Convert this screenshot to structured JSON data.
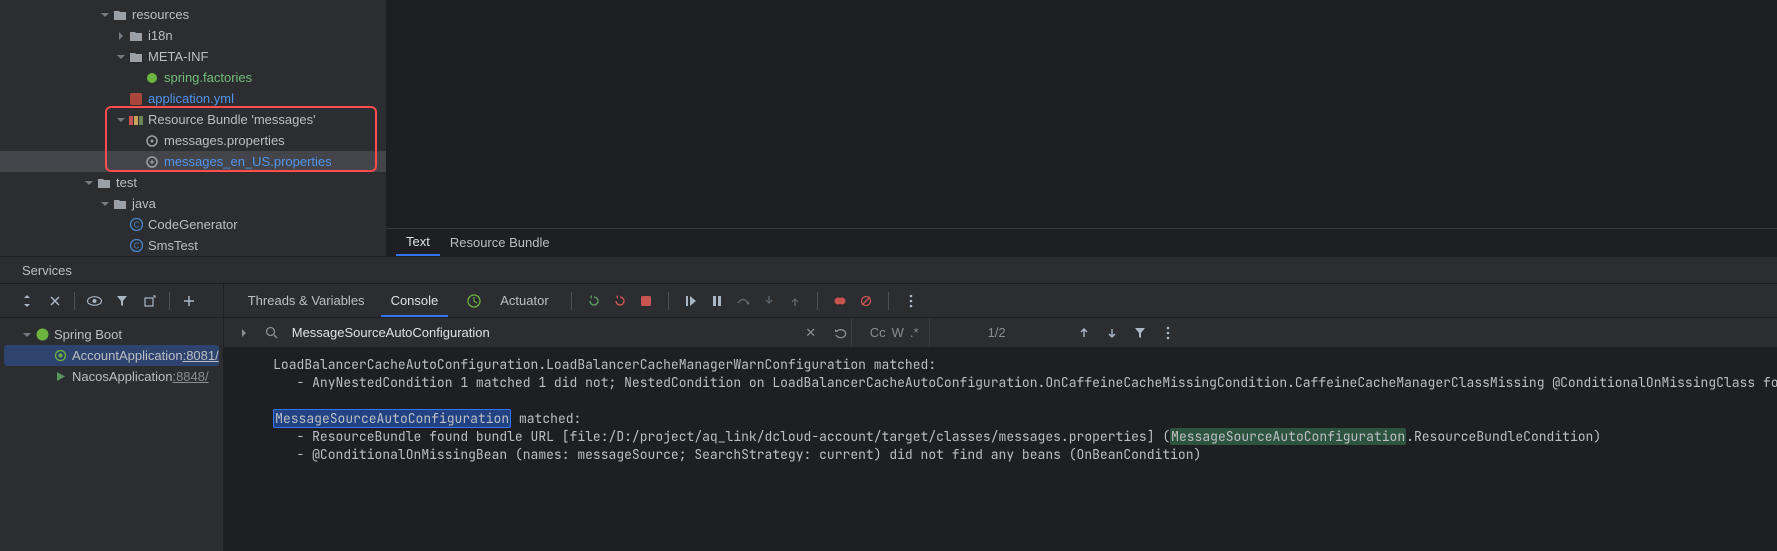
{
  "tree": {
    "resources": "resources",
    "i18n": "i18n",
    "metainf": "META-INF",
    "spring_factories": "spring.factories",
    "application_yml": "application.yml",
    "bundle": "Resource Bundle 'messages'",
    "msg_props": "messages.properties",
    "msg_en": "messages_en_US.properties",
    "test": "test",
    "java": "java",
    "codegen": "CodeGenerator",
    "smstest": "SmsTest"
  },
  "editor": {
    "tab_text": "Text",
    "tab_bundle": "Resource Bundle"
  },
  "services": {
    "header": "Services",
    "spring_boot": "Spring Boot",
    "account_app": "AccountApplication ",
    "account_port": ":8081/",
    "nacos_app": "NacosApplication ",
    "nacos_port": ":8848/"
  },
  "console": {
    "tab_threads": "Threads & Variables",
    "tab_console": "Console",
    "tab_actuator": "Actuator",
    "search_value": "MessageSourceAutoConfiguration",
    "search_count": "1/2",
    "line1": "   LoadBalancerCacheAutoConfiguration.LoadBalancerCacheManagerWarnConfiguration matched:",
    "line2": "      - AnyNestedCondition 1 matched 1 did not; NestedCondition on LoadBalancerCacheAutoConfiguration.OnCaffeineCacheMissingCondition.CaffeineCacheManagerClassMissing @ConditionalOnMissingClass found unwanted cl",
    "hl1": "MessageSourceAutoConfiguration",
    "line3_suffix": " matched:",
    "line4_pre": "      - ResourceBundle found bundle URL [file:/D:/project/aq_link/dcloud-account/target/classes/messages.properties] (",
    "hl2": "MessageSourceAutoConfiguration",
    "line4_post": ".ResourceBundleCondition)",
    "line5": "      - @ConditionalOnMissingBean (names: messageSource; SearchStrategy: current) did not find any beans (OnBeanCondition)"
  }
}
